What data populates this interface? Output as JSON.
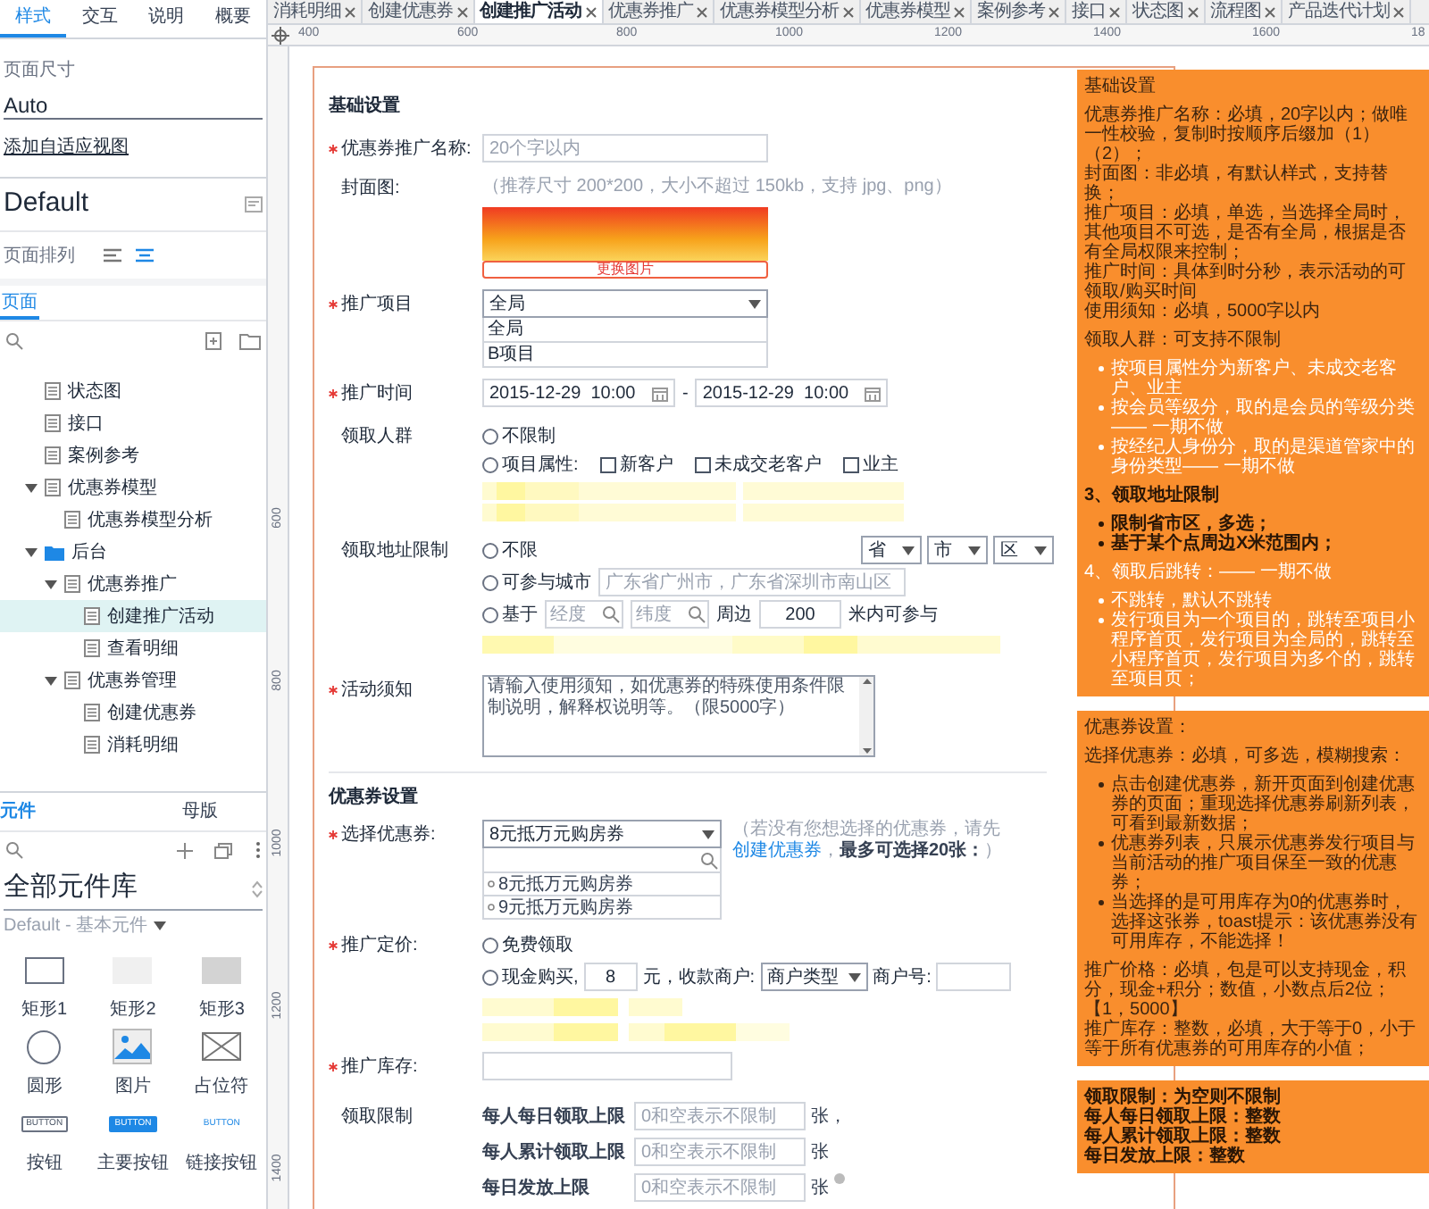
{
  "left_panel": {
    "inspector_tabs": [
      {
        "label": "样式",
        "selected": true
      },
      {
        "label": "交互",
        "selected": false
      },
      {
        "label": "说明",
        "selected": false
      },
      {
        "label": "概要",
        "selected": false
      }
    ],
    "page_size": {
      "label": "页面尺寸",
      "value": "Auto"
    },
    "adaptive_view_link": "添加自适应视图",
    "page_style": "Default",
    "page_align": {
      "label": "页面排列",
      "options": [
        {
          "kind": "left",
          "selected": false
        },
        {
          "kind": "center",
          "selected": true
        }
      ]
    },
    "pages": {
      "title": "页面",
      "tree": [
        {
          "label": "状态图",
          "kind": "page",
          "selected": false
        },
        {
          "label": "接口",
          "kind": "page",
          "selected": false
        },
        {
          "label": "案例参考",
          "kind": "page",
          "selected": false
        },
        {
          "label": "优惠券模型",
          "kind": "page",
          "selected": false,
          "expanded": true,
          "children": [
            {
              "label": "优惠券模型分析",
              "kind": "page",
              "selected": false
            }
          ]
        },
        {
          "label": "后台",
          "kind": "folder",
          "selected": false,
          "expanded": true,
          "children": [
            {
              "label": "优惠券推广",
              "kind": "page",
              "selected": false,
              "expanded": true,
              "children": [
                {
                  "label": "创建推广活动",
                  "kind": "page",
                  "selected": true
                },
                {
                  "label": "查看明细",
                  "kind": "page",
                  "selected": false
                }
              ]
            },
            {
              "label": "优惠券管理",
              "kind": "page",
              "selected": false,
              "expanded": true,
              "children": [
                {
                  "label": "创建优惠券",
                  "kind": "page",
                  "selected": false
                },
                {
                  "label": "消耗明细",
                  "kind": "page",
                  "selected": false
                }
              ]
            }
          ]
        }
      ]
    },
    "library_tabs": [
      {
        "label": "元件",
        "selected": true
      },
      {
        "label": "母版",
        "selected": false
      }
    ],
    "library": {
      "name": "全部元件库",
      "subtitle": "Default - 基本元件"
    },
    "widgets": [
      {
        "kind": "rect_outline",
        "label": "矩形1"
      },
      {
        "kind": "rect_light",
        "label": "矩形2"
      },
      {
        "kind": "rect_gray",
        "label": "矩形3"
      },
      {
        "kind": "circle",
        "label": "圆形"
      },
      {
        "kind": "image",
        "label": "图片"
      },
      {
        "kind": "placeholder",
        "label": "占位符"
      },
      {
        "kind": "button",
        "label": "按钮",
        "icon_text": "BUTTON"
      },
      {
        "kind": "primary_button",
        "label": "主要按钮",
        "icon_text": "BUTTON"
      },
      {
        "kind": "link_button",
        "label": "链接按钮",
        "icon_text": "BUTTON"
      }
    ]
  },
  "doc_tabs": [
    {
      "label": "消耗明细",
      "selected": false
    },
    {
      "label": "创建优惠券",
      "selected": false
    },
    {
      "label": "创建推广活动",
      "selected": true
    },
    {
      "label": "优惠券推广",
      "selected": false
    },
    {
      "label": "优惠券模型分析",
      "selected": false
    },
    {
      "label": "优惠券模型",
      "selected": false
    },
    {
      "label": "案例参考",
      "selected": false
    },
    {
      "label": "接口",
      "selected": false
    },
    {
      "label": "状态图",
      "selected": false
    },
    {
      "label": "流程图",
      "selected": false
    },
    {
      "label": "产品迭代计划",
      "selected": false
    }
  ],
  "ruler": {
    "x_labels": [
      "400",
      "600",
      "800",
      "1000",
      "1200",
      "1400",
      "1600",
      "18"
    ],
    "y_labels": [
      "600",
      "800",
      "1000",
      "1200",
      "1400"
    ]
  },
  "basic": {
    "title": "基础设置",
    "name_field": {
      "label": "优惠券推广名称:",
      "required": true,
      "placeholder": "20个字以内"
    },
    "cover": {
      "label": "封面图:",
      "required": false,
      "hint": "（推荐尺寸 200*200，大小不超过 150kb，支持 jpg、png）",
      "change_button": "更换图片"
    },
    "project": {
      "label": "推广项目",
      "required": true,
      "value": "全局",
      "options": [
        "全局",
        "B项目"
      ]
    },
    "time": {
      "label": "推广时间",
      "required": true,
      "start": "2015-12-29  10:00",
      "separator": "-",
      "end": "2015-12-29  10:00"
    },
    "audience": {
      "label": "领取人群",
      "required": false,
      "options": [
        {
          "label": "不限制",
          "selected": false
        },
        {
          "label": "项目属性:",
          "selected": false
        }
      ],
      "checkboxes": [
        {
          "label": "新客户",
          "checked": false
        },
        {
          "label": "未成交老客户",
          "checked": false
        },
        {
          "label": "业主",
          "checked": false
        }
      ]
    },
    "address": {
      "label": "领取地址限制",
      "required": false,
      "region_selects": [
        "省",
        "市",
        "区"
      ],
      "options": [
        {
          "kind": "plain",
          "label": "不限",
          "selected": false
        },
        {
          "kind": "city",
          "label": "可参与城市",
          "selected": false,
          "placeholder": "广东省广州市，广东省深圳市南山区"
        },
        {
          "kind": "point",
          "label": "基于",
          "selected": false,
          "longitude_placeholder": "经度",
          "latitude_placeholder": "纬度",
          "around": "周边",
          "distance": "200",
          "suffix": "米内可参与"
        }
      ]
    },
    "notice": {
      "label": "活动须知",
      "required": true,
      "placeholder": "请输入使用须知，如优惠券的特殊使用条件限制说明，解释权说明等。（限5000字）"
    }
  },
  "coupon": {
    "title": "优惠券设置",
    "select": {
      "label": "选择优惠券:",
      "required": true,
      "value": "8元抵万元购房券",
      "options": [
        "8元抵万元购房券",
        "9元抵万元购房券"
      ],
      "hint_before": "（若没有您想选择的优惠券，请先",
      "hint_link": "创建优惠券",
      "hint_after": "，**最多可选择20张：**）"
    },
    "price": {
      "label": "推广定价:",
      "required": true,
      "options": [
        {
          "kind": "free",
          "label": "免费领取",
          "selected": false
        },
        {
          "kind": "cash",
          "label": "现金购买,",
          "selected": false,
          "value": "8",
          "unit": "元，收款商户:",
          "merchant_type": "商户类型",
          "merchant_no_label": "商户号:"
        }
      ]
    },
    "stock": {
      "label": "推广库存:",
      "required": true
    },
    "limits": {
      "label": "领取限制",
      "required": false,
      "fields": [
        {
          "label": "每人每日领取上限",
          "placeholder": "0和空表示不限制",
          "unit": "张，"
        },
        {
          "label": "每人累计领取上限",
          "placeholder": "0和空表示不限制",
          "unit": "张"
        },
        {
          "label": "每日发放上限",
          "placeholder": "0和空表示不限制",
          "unit": "张"
        }
      ]
    }
  },
  "notes": [
    {
      "blocks": [
        {
          "kind": "text_dark",
          "lines": [
            "基础设置"
          ]
        },
        {
          "kind": "text_dark",
          "lines": [
            "优惠券推广名称：必填，20字以内；做唯一性校验，复制时按顺序后缀加（1）（2）；",
            "封面图：非必填，有默认样式，支持替换；",
            "推广项目：必填，单选，当选择全局时，其他项目不可选，是否有全局，根据是否有全局权限来控制；",
            "推广时间：具体到时分秒，表示活动的可领取/购买时间",
            "使用须知：必填，5000字以内"
          ]
        },
        {
          "kind": "text_dark",
          "lines": [
            "领取人群：可支持不限制"
          ]
        },
        {
          "kind": "list_light",
          "items": [
            "按项目属性分为新客户、未成交老客户、业主",
            "按会员等级分，取的是会员的等级分类—— 一期不做",
            "按经纪人身份分，取的是渠道管家中的身份类型—— 一期不做"
          ]
        },
        {
          "kind": "text_bold",
          "lines": [
            "3、领取地址限制"
          ]
        },
        {
          "kind": "list_bold",
          "items": [
            "限制省市区，多选；",
            "基于某个点周边X米范围内；"
          ]
        },
        {
          "kind": "text_light",
          "lines": [
            "4、领取后跳转：—— 一期不做"
          ]
        },
        {
          "kind": "list_light",
          "items": [
            "不跳转，默认不跳转",
            "发行项目为一个项目的，跳转至项目小程序首页，发行项目为全局的，跳转至小程序首页，发行项目为多个的，跳转至项目页；"
          ]
        }
      ]
    },
    {
      "blocks": [
        {
          "kind": "text_dark",
          "lines": [
            "优惠券设置："
          ]
        },
        {
          "kind": "text_dark",
          "lines": [
            "选择优惠券：必填，可多选，模糊搜索："
          ]
        },
        {
          "kind": "list_dark",
          "items": [
            "点击创建优惠券，新开页面到创建优惠券的页面；重现选择优惠券刷新列表，可看到最新数据；",
            "优惠券列表，只展示优惠券发行项目与当前活动的推广项目保至一致的优惠券；",
            "当选择的是可用库存为0的优惠券时，选择这张券，toast提示：该优惠券没有可用库存，不能选择！"
          ]
        },
        {
          "kind": "text_dark",
          "lines": [
            "推广价格：必填，包是可以支持现金，积分，现金+积分；数值，小数点后2位；【1，5000】",
            "推广库存：整数，必填，大于等于0，小于等于所有优惠券的可用库存的小值；"
          ]
        }
      ]
    },
    {
      "blocks": [
        {
          "kind": "text_bold",
          "lines": [
            "领取限制：为空则不限制",
            "每人每日领取上限：整数",
            "每人累计领取上限：整数",
            "每日发放上限：整数"
          ]
        }
      ]
    }
  ]
}
